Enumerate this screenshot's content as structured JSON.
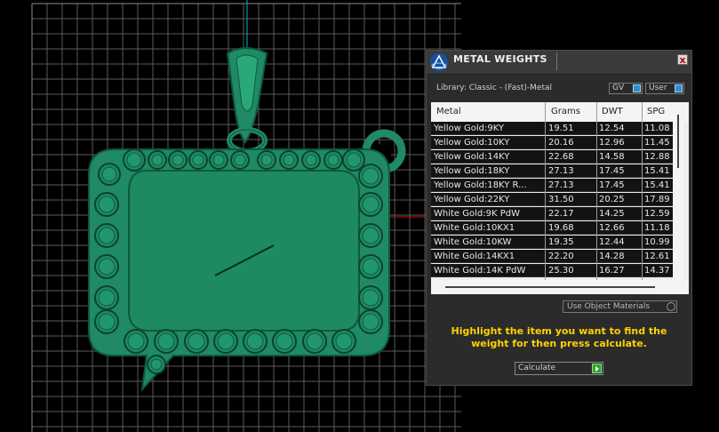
{
  "panel": {
    "title": "METAL WEIGHTS",
    "close_symbol": "x",
    "library_label": "Library: Classic - (Fast)-Metal",
    "unit_combo": "GV",
    "source_combo": "User",
    "use_object_materials": "Use Object Materials",
    "instructions": "Highlight the item you want to find the weight for then press calculate.",
    "calculate_label": "Calculate",
    "columns": [
      "Metal",
      "Grams",
      "DWT",
      "SPG"
    ],
    "rows": [
      {
        "metal": "Yellow Gold:9KY",
        "grams": "19.51",
        "dwt": "12.54",
        "spg": "11.08"
      },
      {
        "metal": "Yellow Gold:10KY",
        "grams": "20.16",
        "dwt": "12.96",
        "spg": "11.45"
      },
      {
        "metal": "Yellow Gold:14KY",
        "grams": "22.68",
        "dwt": "14.58",
        "spg": "12.88"
      },
      {
        "metal": "Yellow Gold:18KY",
        "grams": "27.13",
        "dwt": "17.45",
        "spg": "15.41"
      },
      {
        "metal": "Yellow Gold:18KY R...",
        "grams": "27.13",
        "dwt": "17.45",
        "spg": "15.41"
      },
      {
        "metal": "Yellow Gold:22KY",
        "grams": "31.50",
        "dwt": "20.25",
        "spg": "17.89"
      },
      {
        "metal": "White Gold:9K PdW",
        "grams": "22.17",
        "dwt": "14.25",
        "spg": "12.59"
      },
      {
        "metal": "White Gold:10KX1",
        "grams": "19.68",
        "dwt": "12.66",
        "spg": "11.18"
      },
      {
        "metal": "White Gold:10KW",
        "grams": "19.35",
        "dwt": "12.44",
        "spg": "10.99"
      },
      {
        "metal": "White Gold:14KX1",
        "grams": "22.20",
        "dwt": "14.28",
        "spg": "12.61"
      },
      {
        "metal": "White Gold:14K PdW",
        "grams": "25.30",
        "dwt": "16.27",
        "spg": "14.37"
      }
    ]
  },
  "colors": {
    "pendant": "#1f8a64",
    "pendant_dark": "#0e5a3f",
    "grid": "#5a5a5a",
    "instructions": "#ffd200",
    "axis_red": "#d01010",
    "axis_cyan": "#00b4d0"
  }
}
